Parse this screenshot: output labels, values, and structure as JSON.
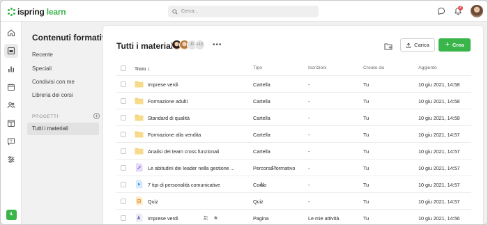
{
  "app": {
    "logo_prefix": "ispring",
    "logo_suffix": "learn",
    "brand_color": "#39b54a"
  },
  "search": {
    "placeholder": "Cerca..."
  },
  "notifications": {
    "count": "2"
  },
  "rail": {
    "items": [
      "home-icon",
      "courses-icon",
      "reports-icon",
      "calendar-icon",
      "users-icon",
      "content-icon",
      "feedback-icon",
      "settings-icon"
    ],
    "user_initials": "IL"
  },
  "sidebar": {
    "title": "Contenuti formativi",
    "links": [
      "Recente",
      "Speciali",
      "Condivisi con me",
      "Libreria dei corsi"
    ],
    "section_label": "PROGETTI",
    "active_item": "Tutti i materiali"
  },
  "main": {
    "title": "Tutti i materiali",
    "collaborators": {
      "initials": "JD",
      "more": "+13"
    },
    "upload_label": "Carica",
    "create_label": "Crea",
    "columns": {
      "title": "Titolo",
      "type": "Tipo",
      "enrollments": "Iscrizioni",
      "created_by": "Creato da",
      "updated": "Aggiunto"
    },
    "rows": [
      {
        "icon": "folder-icon",
        "name": "Imprese verdi",
        "type": "Cartella",
        "enrollments": "-",
        "created_by": "Tu",
        "updated": "10 giu 2021, 14:58"
      },
      {
        "icon": "folder-icon",
        "name": "Formazione adulti",
        "type": "Cartella",
        "enrollments": "-",
        "created_by": "Tu",
        "updated": "10 giu 2021, 14:58"
      },
      {
        "icon": "folder-icon",
        "name": "Standard di qualità",
        "type": "Cartella",
        "enrollments": "-",
        "created_by": "Tu",
        "updated": "10 giu 2021, 14:58"
      },
      {
        "icon": "folder-icon",
        "name": "Formazione alla vendita",
        "type": "Cartella",
        "enrollments": "-",
        "created_by": "Tu",
        "updated": "10 giu 2021, 14:57"
      },
      {
        "icon": "folder-icon",
        "name": "Analisi dei team cross funzionali",
        "type": "Cartella",
        "enrollments": "-",
        "created_by": "Tu",
        "updated": "10 giu 2021, 14:57"
      },
      {
        "icon": "learning-path-icon",
        "name": "Le abitudini dei leader nella gestione ...",
        "type": "Percorso formativo",
        "enrollments": "-",
        "created_by": "Tu",
        "updated": "10 giu 2021, 14:57"
      },
      {
        "icon": "course-icon",
        "name": "7 tipi di personalità comunicative",
        "type": "Corso",
        "enrollments": "-",
        "created_by": "Tu",
        "updated": "10 giu 2021, 14:57"
      },
      {
        "icon": "quiz-icon",
        "name": "Quiz",
        "type": "Quiz",
        "enrollments": "-",
        "created_by": "Tu",
        "updated": "10 giu 2021, 14:57"
      },
      {
        "icon": "page-icon",
        "name": "Imprese verdi",
        "type": "Pagina",
        "enrollments": "Le mie attività",
        "created_by": "Tu",
        "updated": "10 giu 2021, 14:56"
      }
    ]
  }
}
